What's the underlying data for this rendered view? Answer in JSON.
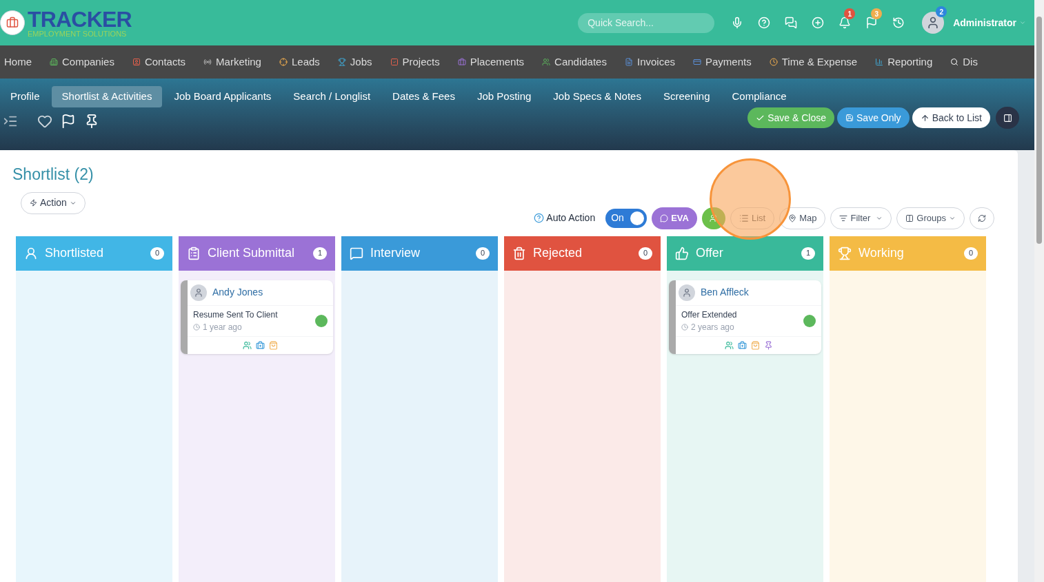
{
  "logo": {
    "title": "TRACKER",
    "subtitle": "EMPLOYMENT SOLUTIONS"
  },
  "search": {
    "placeholder": "Quick Search..."
  },
  "header_badges": {
    "notifications": "1",
    "flags": "3",
    "avatar": "2"
  },
  "user": {
    "name": "Administrator"
  },
  "nav": [
    {
      "label": "Home"
    },
    {
      "label": "Companies"
    },
    {
      "label": "Contacts"
    },
    {
      "label": "Marketing"
    },
    {
      "label": "Leads"
    },
    {
      "label": "Jobs"
    },
    {
      "label": "Projects"
    },
    {
      "label": "Placements"
    },
    {
      "label": "Candidates"
    },
    {
      "label": "Invoices"
    },
    {
      "label": "Payments"
    },
    {
      "label": "Time & Expense"
    },
    {
      "label": "Reporting"
    },
    {
      "label": "Dis"
    }
  ],
  "tabs": [
    {
      "label": "Profile",
      "selected": false
    },
    {
      "label": "Shortlist & Activities",
      "selected": true
    },
    {
      "label": "Job Board Applicants",
      "selected": false
    },
    {
      "label": "Search / Longlist",
      "selected": false
    },
    {
      "label": "Dates & Fees",
      "selected": false
    },
    {
      "label": "Job Posting",
      "selected": false
    },
    {
      "label": "Job Specs & Notes",
      "selected": false
    },
    {
      "label": "Screening",
      "selected": false
    },
    {
      "label": "Compliance",
      "selected": false
    }
  ],
  "actions": {
    "save_close": "Save & Close",
    "save_only": "Save Only",
    "back": "Back to List"
  },
  "page_title": "Shortlist (2)",
  "action_menu": "Action",
  "toolbar": {
    "auto_action": "Auto Action",
    "toggle": {
      "label": "On",
      "on": true
    },
    "eva": "EVA",
    "list": "List",
    "map": "Map",
    "filter": "Filter",
    "groups": "Groups"
  },
  "columns": [
    {
      "title": "Shortlisted",
      "count": "0",
      "color": "#41b6e6"
    },
    {
      "title": "Client Submittal",
      "count": "1",
      "color": "#9b72d6",
      "cards": [
        {
          "name": "Andy Jones",
          "status": "Resume Sent To Client",
          "time": "1 year ago",
          "pinned": false
        }
      ]
    },
    {
      "title": "Interview",
      "count": "0",
      "color": "#3a9ad9"
    },
    {
      "title": "Rejected",
      "count": "0",
      "color": "#e05340"
    },
    {
      "title": "Offer",
      "count": "1",
      "color": "#39b99a",
      "cards": [
        {
          "name": "Ben Affleck",
          "status": "Offer Extended",
          "time": "2 years ago",
          "pinned": true
        }
      ]
    },
    {
      "title": "Working",
      "count": "0",
      "color": "#f4bb45"
    }
  ]
}
